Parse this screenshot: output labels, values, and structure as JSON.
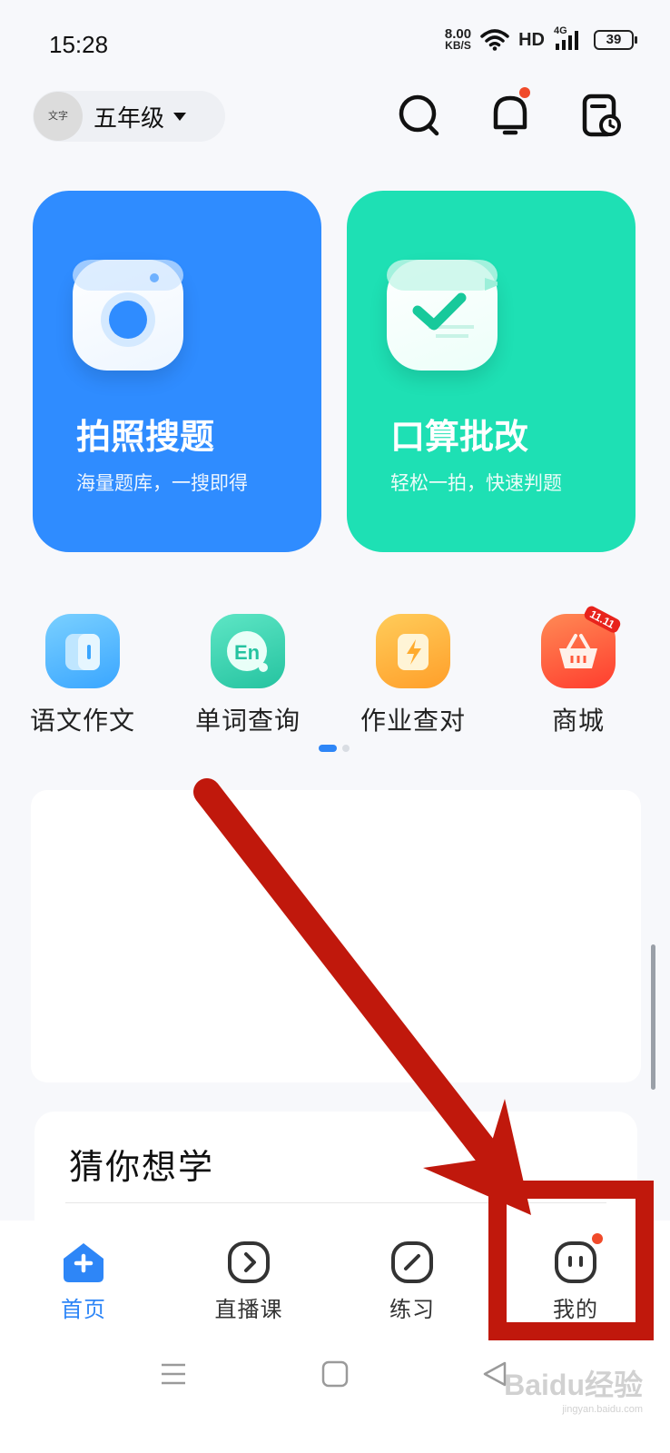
{
  "status_bar": {
    "time": "15:28",
    "speed_value": "8.00",
    "speed_unit": "KB/S",
    "network_label": "HD",
    "signal_type": "4G",
    "battery": "39"
  },
  "header": {
    "grade": "五年级",
    "avatar_text": "文字",
    "icons": [
      "search-icon",
      "bell-icon",
      "clock-doc-icon"
    ]
  },
  "feature_cards": [
    {
      "title": "拍照搜题",
      "subtitle": "海量题库，一搜即得",
      "color": "#2f8cff",
      "icon": "camera-icon"
    },
    {
      "title": "口算批改",
      "subtitle": "轻松一拍，快速判题",
      "color": "#1ee0b4",
      "icon": "check-board-icon"
    }
  ],
  "quick_entries": [
    {
      "label": "语文作文",
      "icon": "notebook-icon",
      "color": "#4fb6ff"
    },
    {
      "label": "单词查询",
      "icon": "en-icon",
      "color": "#37d3b3"
    },
    {
      "label": "作业查对",
      "icon": "lightning-icon",
      "color": "#ffb53d"
    },
    {
      "label": "商城",
      "icon": "basket-icon",
      "color": "#ff5a3c",
      "badge": "11.11"
    }
  ],
  "guess_section": {
    "title": "猜你想学"
  },
  "bottom_nav": [
    {
      "label": "首页",
      "icon": "home-icon",
      "active": true
    },
    {
      "label": "直播课",
      "icon": "play-icon",
      "active": false
    },
    {
      "label": "练习",
      "icon": "pen-icon",
      "active": false
    },
    {
      "label": "我的",
      "icon": "face-icon",
      "active": false
    }
  ],
  "watermark": {
    "brand": "Baidu经验",
    "url": "jingyan.baidu.com"
  },
  "colors": {
    "accent": "#2e86f7",
    "annotation": "#c0180c"
  }
}
